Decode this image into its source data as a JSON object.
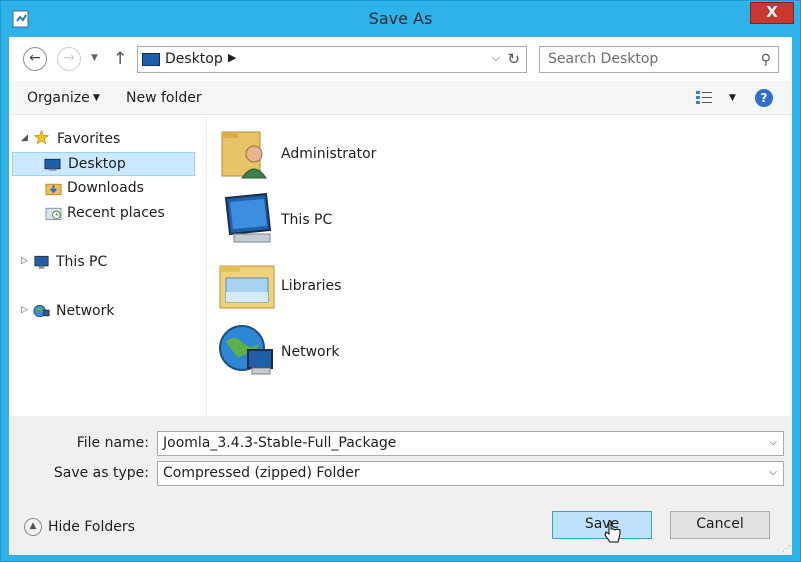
{
  "window": {
    "title": "Save As",
    "close_glyph": "X",
    "colors": {
      "frame": "#2fb2e8",
      "close": "#c7392e",
      "selection": "#cce8ff",
      "save_button": "#bde2f9"
    }
  },
  "nav": {
    "back_glyph": "←",
    "forward_glyph": "→",
    "recent_glyph": "▼",
    "up_glyph": "↑",
    "address": {
      "location": "Desktop",
      "arrow": "▶",
      "dropdown_glyph": "⌵",
      "refresh_glyph": "↻"
    },
    "search": {
      "placeholder": "Search Desktop",
      "icon": "⚲"
    }
  },
  "toolbar": {
    "organize_label": "Organize",
    "organize_caret": "▼",
    "new_folder_label": "New folder",
    "view_caret": "▼",
    "help_glyph": "?"
  },
  "tree": {
    "expanded_glyph": "◢",
    "collapsed_glyph": "▷",
    "favorites": "Favorites",
    "desktop": "Desktop",
    "downloads": "Downloads",
    "recent_places": "Recent places",
    "this_pc": "This PC",
    "network": "Network"
  },
  "files": [
    {
      "label": "Administrator",
      "icon": "user-folder-icon"
    },
    {
      "label": "This PC",
      "icon": "computer-icon"
    },
    {
      "label": "Libraries",
      "icon": "libraries-icon"
    },
    {
      "label": "Network",
      "icon": "network-globe-icon"
    }
  ],
  "form": {
    "file_name_label": "File name:",
    "file_name_value": "Joomla_3.4.3-Stable-Full_Package",
    "save_type_label": "Save as type:",
    "save_type_value": "Compressed (zipped) Folder",
    "combo_caret": "⌵"
  },
  "footer": {
    "hide_folders_label": "Hide Folders",
    "hide_glyph": "▲",
    "save_label": "Save",
    "cancel_label": "Cancel",
    "grip": "⋰"
  }
}
